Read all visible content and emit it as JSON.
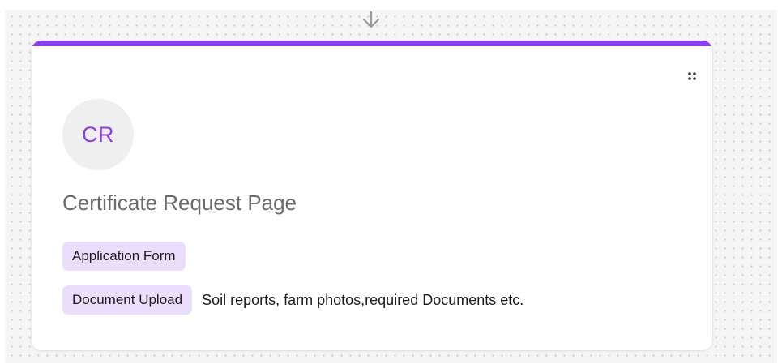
{
  "node": {
    "avatar_initials": "CR",
    "title": "Certificate Request Page",
    "accent_color": "#8b3ff0",
    "drag_handle_icon": "drag-handle-icon",
    "connector_icon": "arrow-down-icon",
    "items": [
      {
        "tag": "Application Form",
        "description": ""
      },
      {
        "tag": "Document Upload",
        "description": "Soil reports, farm photos,required Documents etc."
      }
    ]
  }
}
